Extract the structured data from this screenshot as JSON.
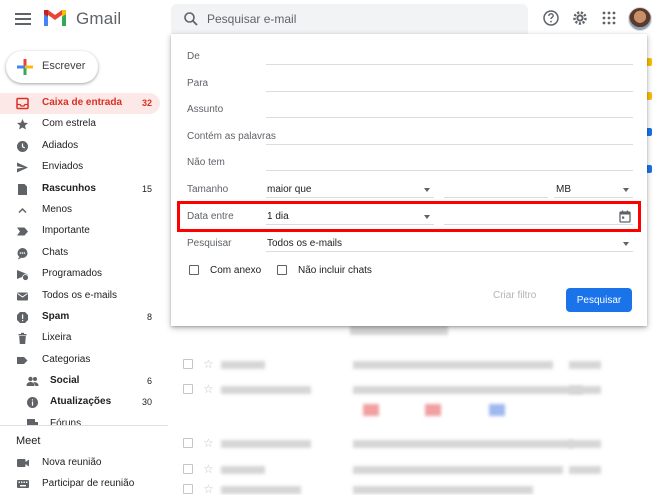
{
  "header": {
    "app_name": "Gmail",
    "search_placeholder": "Pesquisar e-mail"
  },
  "compose": {
    "label": "Escrever"
  },
  "sidebar": {
    "items": [
      {
        "label": "Caixa de entrada",
        "count": "32",
        "icon": "inbox-icon",
        "active": true
      },
      {
        "label": "Com estrela",
        "count": "",
        "icon": "star-icon"
      },
      {
        "label": "Adiados",
        "count": "",
        "icon": "clock-icon"
      },
      {
        "label": "Enviados",
        "count": "",
        "icon": "send-icon"
      },
      {
        "label": "Rascunhos",
        "count": "15",
        "icon": "draft-icon",
        "bold": true
      },
      {
        "label": "Menos",
        "count": "",
        "icon": "chevron-up-icon"
      },
      {
        "label": "Importante",
        "count": "",
        "icon": "label-important-icon"
      },
      {
        "label": "Chats",
        "count": "",
        "icon": "chat-icon"
      },
      {
        "label": "Programados",
        "count": "",
        "icon": "scheduled-icon"
      },
      {
        "label": "Todos os e-mails",
        "count": "",
        "icon": "mail-icon"
      },
      {
        "label": "Spam",
        "count": "8",
        "icon": "spam-icon",
        "bold": true
      },
      {
        "label": "Lixeira",
        "count": "",
        "icon": "trash-icon"
      },
      {
        "label": "Categorias",
        "count": "",
        "icon": "label-icon"
      },
      {
        "label": "Social",
        "count": "6",
        "icon": "people-icon",
        "bold": true,
        "sub": true
      },
      {
        "label": "Atualizações",
        "count": "30",
        "icon": "info-icon",
        "bold": true,
        "sub": true
      },
      {
        "label": "Fóruns",
        "count": "",
        "icon": "forum-icon",
        "sub": true
      }
    ]
  },
  "meet": {
    "title": "Meet",
    "new_meeting": "Nova reunião",
    "join_meeting": "Participar de reunião"
  },
  "advanced_search": {
    "from_label": "De",
    "to_label": "Para",
    "subject_label": "Assunto",
    "has_words_label": "Contém as palavras",
    "doesnt_have_label": "Não tem",
    "size_label": "Tamanho",
    "size_operator": "maior que",
    "size_unit": "MB",
    "date_label": "Data entre",
    "date_value": "1 dia",
    "search_in_label": "Pesquisar",
    "search_in_value": "Todos os e-mails",
    "has_attachment_label": "Com anexo",
    "exclude_chats_label": "Não incluir chats",
    "create_filter_label": "Criar filtro",
    "search_button_label": "Pesquisar"
  },
  "colors": {
    "accent_red": "#d93025",
    "highlight_box": "#ff0000",
    "primary_blue": "#1a73e8"
  }
}
